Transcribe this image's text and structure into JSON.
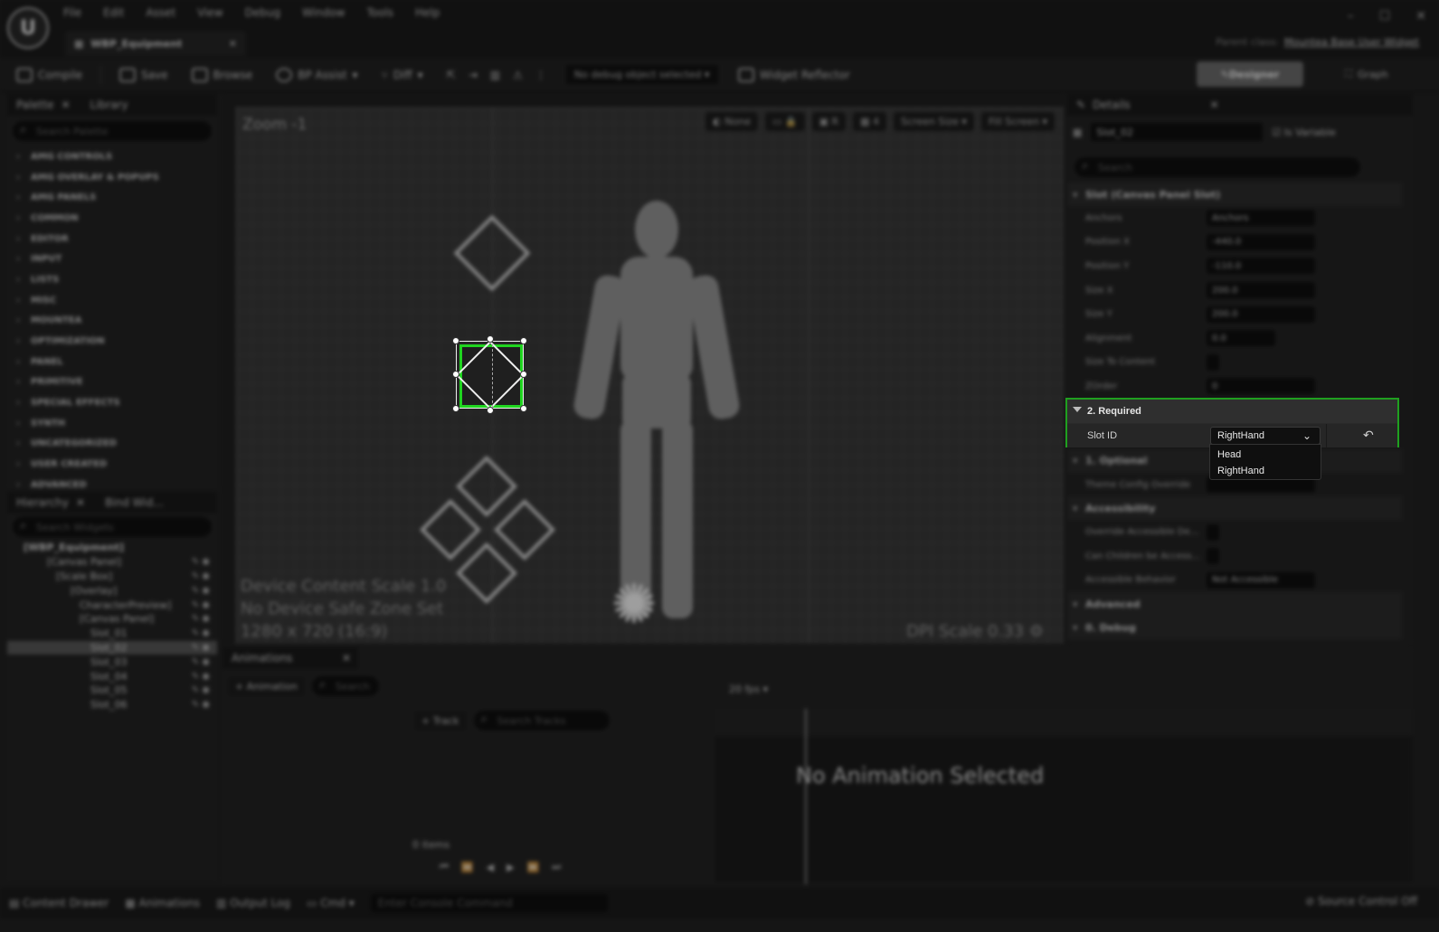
{
  "app": {
    "logo_text": "U",
    "menu": [
      "File",
      "Edit",
      "Asset",
      "View",
      "Debug",
      "Window",
      "Tools",
      "Help"
    ],
    "document_tab": "WBP_Equipment",
    "parent_class_label": "Parent class:",
    "parent_class_value": "Mountea Base User Widget"
  },
  "toolbar": {
    "compile": "Compile",
    "save": "Save",
    "browse": "Browse",
    "bp_assist": "BP Assist",
    "diff": "Diff",
    "debug_object": "No debug object selected",
    "widget_reflector": "Widget Reflector",
    "designer": "Designer",
    "graph": "Graph"
  },
  "palette": {
    "tab_palette": "Palette",
    "tab_library": "Library",
    "search_placeholder": "Search Palette",
    "categories": [
      "AMG CONTROLS",
      "AMG OVERLAY & POPUPS",
      "AMG PANELS",
      "COMMON",
      "EDITOR",
      "INPUT",
      "LISTS",
      "MISC",
      "MOUNTEA",
      "OPTIMIZATION",
      "PANEL",
      "PRIMITIVE",
      "SPECIAL EFFECTS",
      "SYNTH",
      "UNCATEGORIZED",
      "USER CREATED",
      "ADVANCED"
    ]
  },
  "hierarchy": {
    "tab_hierarchy": "Hierarchy",
    "tab_bind": "Bind Wid...",
    "search_placeholder": "Search Widgets",
    "items": [
      "[WBP_Equipment]",
      "[Canvas Panel]",
      "[Scale Box]",
      "[Overlay]",
      "CharacterPreview]",
      "[Canvas Panel]",
      "Slot_01",
      "Slot_02",
      "Slot_03",
      "Slot_04",
      "Slot_05",
      "Slot_06"
    ]
  },
  "viewport": {
    "zoom": "Zoom -1",
    "none_label": "None",
    "grid_value": "4",
    "screen_size": "Screen Size",
    "fill_screen": "Fill Screen",
    "info_lines": [
      "Device Content Scale 1.0",
      "No Device Safe Zone Set",
      "1280 x 720 (16:9)"
    ],
    "dpi_scale": "DPI Scale 0.33"
  },
  "details": {
    "tab": "Details",
    "widget_name": "Slot_02",
    "is_variable": "Is Variable",
    "search_placeholder": "Search",
    "slot_section": "Slot (Canvas Panel Slot)",
    "props": [
      {
        "label": "Anchors",
        "value": "Anchors"
      },
      {
        "label": "Position X",
        "value": "-440.0"
      },
      {
        "label": "Position Y",
        "value": "-110.0"
      },
      {
        "label": "Size X",
        "value": "200.0"
      },
      {
        "label": "Size Y",
        "value": "200.0"
      },
      {
        "label": "Alignment",
        "value": "0.0"
      },
      {
        "label": "Size To Content",
        "value": ""
      },
      {
        "label": "ZOrder",
        "value": "0"
      }
    ],
    "required_section": "2. Required",
    "slot_id_label": "Slot ID",
    "slot_id_value": "RightHand",
    "slot_id_options": [
      "Head",
      "RightHand"
    ],
    "optional_section": "1. Optional",
    "theme_config": "Theme Config Override",
    "accessibility_section": "Accessibility",
    "override_accessible": "Override Accessible De...",
    "can_children": "Can Children be Access...",
    "accessible_behavior": "Accessible Behavior",
    "accessible_value": "Not Accessible",
    "advanced_section": "Advanced",
    "debug_section": "0. Debug"
  },
  "animations": {
    "tab": "Animations",
    "add_button": "Animation",
    "search_placeholder": "Search",
    "track_button": "Track",
    "track_search": "Search Tracks",
    "fps": "20 fps",
    "items_count": "0 items",
    "no_selection": "No Animation Selected"
  },
  "statusbar": {
    "content_drawer": "Content Drawer",
    "animations": "Animations",
    "output_log": "Output Log",
    "cmd": "Cmd",
    "console_placeholder": "Enter Console Command",
    "source_control": "Source Control Off"
  }
}
